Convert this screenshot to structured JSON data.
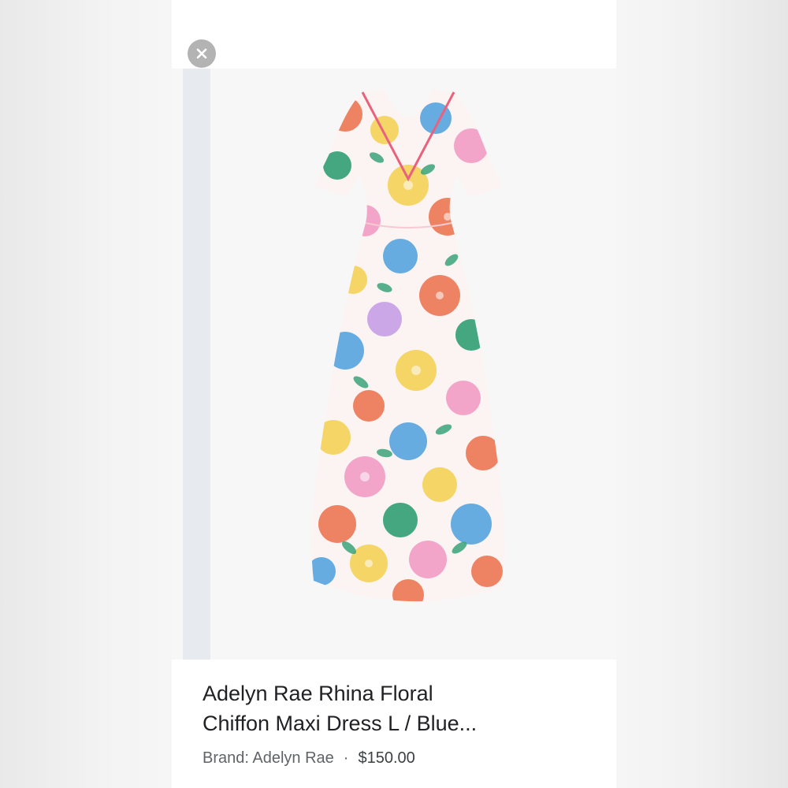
{
  "product": {
    "title_line1": "Adelyn Rae Rhina Floral",
    "title_line2": "Chiffon Maxi Dress L / Blue...",
    "brand_label": "Brand: Adelyn Rae",
    "separator": "·",
    "price": "$150.00",
    "image_icon": "floral-dress-image"
  },
  "controls": {
    "close_icon": "close-icon"
  },
  "colors": {
    "card_background": "#ffffff",
    "image_background": "#f7f7f7",
    "close_button": "#b3b3b3",
    "title_text": "#202124",
    "meta_text": "#5f6368"
  }
}
